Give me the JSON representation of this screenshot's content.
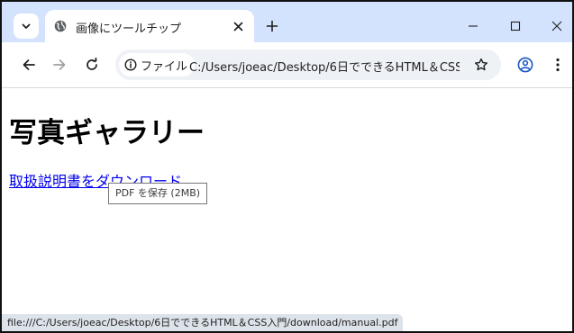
{
  "tab": {
    "title": "画像にツールチップ"
  },
  "omnibox": {
    "site_label": "ファイル",
    "url": "C:/Users/joeac/Desktop/6日でできるHTML＆CSS..."
  },
  "page": {
    "heading": "写真ギャラリー",
    "link_text": "取扱説明書をダウンロード",
    "tooltip": "PDF を保存 (2MB)"
  },
  "status_bar": {
    "url": "file:///C:/Users/joeac/Desktop/6日でできるHTML＆CSS入門/download/manual.pdf"
  },
  "icons": {
    "tab_search": "chevron-down-icon",
    "favicon": "globe-icon",
    "close": "close-icon",
    "new_tab": "plus-icon",
    "minimize": "minimize-icon",
    "maximize": "maximize-icon",
    "window_close": "close-icon",
    "back": "back-arrow-icon",
    "forward": "forward-arrow-icon",
    "reload": "reload-icon",
    "info": "info-icon",
    "bookmark": "star-icon",
    "profile": "profile-icon",
    "menu": "more-vert-icon"
  },
  "colors": {
    "tabstrip_bg": "#d3e3fd",
    "link": "#0000ee",
    "omnibox_bg": "#eef1f6"
  }
}
